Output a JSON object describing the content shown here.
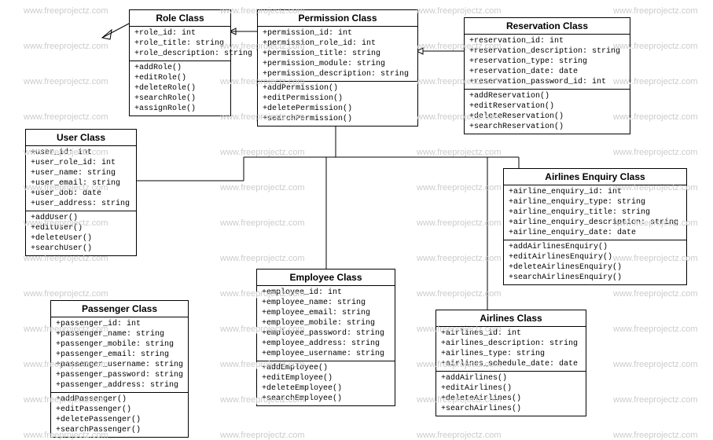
{
  "watermark": "www.freeprojectz.com",
  "classes": {
    "role": {
      "title": "Role Class",
      "attrs": [
        "+role_id: int",
        "+role_title: string",
        "+role_description: string"
      ],
      "ops": [
        "+addRole()",
        "+editRole()",
        "+deleteRole()",
        "+searchRole()",
        "+assignRole()"
      ]
    },
    "permission": {
      "title": "Permission Class",
      "attrs": [
        "+permission_id: int",
        "+permission_role_id: int",
        "+permission_title: string",
        "+permission_module: string",
        "+permission_description: string"
      ],
      "ops": [
        "+addPermission()",
        "+editPermission()",
        "+deletePermission()",
        "+searchPermission()"
      ]
    },
    "reservation": {
      "title": "Reservation Class",
      "attrs": [
        "+reservation_id: int",
        "+reservation_description: string",
        "+reservation_type: string",
        "+reservation_date: date",
        "+reservation_password_id: int"
      ],
      "ops": [
        "+addReservation()",
        "+editReservation()",
        "+deleteReservation()",
        "+searchReservation()"
      ]
    },
    "user": {
      "title": "User Class",
      "attrs": [
        "+user_id: int",
        "+user_role_id: int",
        "+user_name: string",
        "+user_email: string",
        "+user_dob: date",
        "+user_address: string"
      ],
      "ops": [
        "+addUser()",
        "+editUser()",
        "+deleteUser()",
        "+searchUser()"
      ]
    },
    "enquiry": {
      "title": "Airlines Enquiry Class",
      "attrs": [
        "+airline_enquiry_id: int",
        "+airline_enquiry_type: string",
        "+airline_enquiry_title: string",
        "+airline_enquiry_description: string",
        "+airline_enquiry_date: date"
      ],
      "ops": [
        "+addAirlinesEnquiry()",
        "+editAirlinesEnquiry()",
        "+deleteAirlinesEnquiry()",
        "+searchAirlinesEnquiry()"
      ]
    },
    "employee": {
      "title": "Employee Class",
      "attrs": [
        "+employee_id: int",
        "+employee_name: string",
        "+employee_email: string",
        "+employee_mobile: string",
        "+employee_password: string",
        "+employee_address: string",
        "+employee_username: string"
      ],
      "ops": [
        "+addEmployee()",
        "+editEmployee()",
        "+deleteEmployee()",
        "+searchEmployee()"
      ]
    },
    "passenger": {
      "title": "Passenger Class",
      "attrs": [
        "+passenger_id: int",
        "+passenger_name: string",
        "+passenger_mobile: string",
        "+passenger_email: string",
        "+passenger_username: string",
        "+passenger_password: string",
        "+passenger_address: string"
      ],
      "ops": [
        "+addPassenger()",
        "+editPassenger()",
        "+deletePassenger()",
        "+searchPassenger()"
      ]
    },
    "airlines": {
      "title": "Airlines Class",
      "attrs": [
        "+airlines_id: int",
        "+airlines_description: string",
        "+airlines_type: string",
        "+airlines_schedule_date: date"
      ],
      "ops": [
        "+addAirlines()",
        "+editAirlines()",
        "+deleteAirlines()",
        "+searchAirlines()"
      ]
    }
  }
}
